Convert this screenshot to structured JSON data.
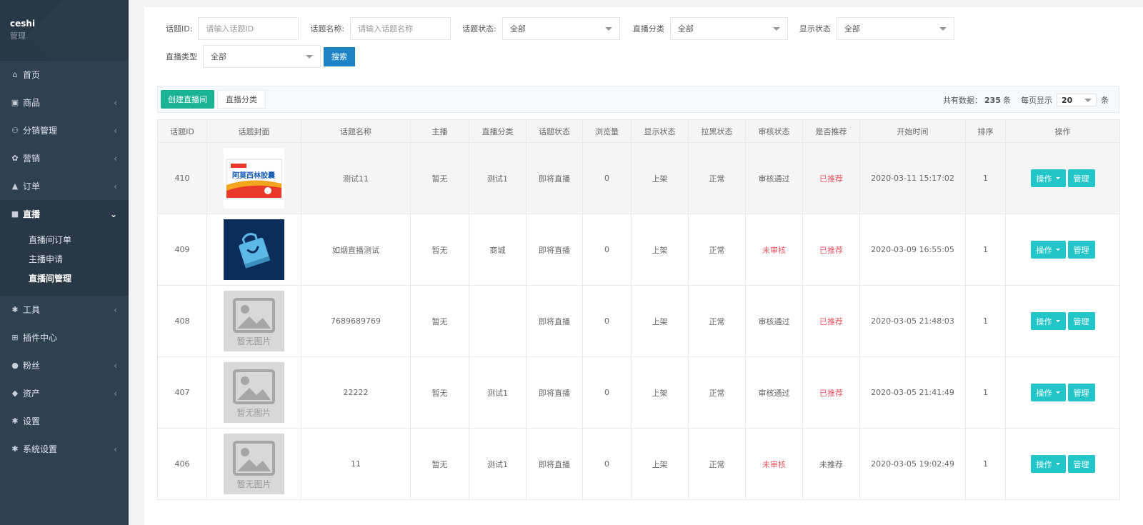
{
  "brand": {
    "name": "ceshi",
    "sub": "管理"
  },
  "menu": [
    {
      "label": "首页",
      "icon": "home-icon",
      "glyph": "⌂",
      "arrow": ""
    },
    {
      "label": "商品",
      "icon": "book-icon",
      "glyph": "▣",
      "arrow": "‹"
    },
    {
      "label": "分销管理",
      "icon": "users-icon",
      "glyph": "⚇",
      "arrow": "‹"
    },
    {
      "label": "营销",
      "icon": "gift-icon",
      "glyph": "✿",
      "arrow": "‹"
    },
    {
      "label": "订单",
      "icon": "bag-icon",
      "glyph": "▲",
      "arrow": "‹"
    },
    {
      "label": "直播",
      "icon": "video-icon",
      "glyph": "■",
      "arrow": "⌄"
    },
    {
      "label": "工具",
      "icon": "cog-icon",
      "glyph": "✱",
      "arrow": "‹"
    },
    {
      "label": "插件中心",
      "icon": "sitemap-icon",
      "glyph": "⊞",
      "arrow": ""
    },
    {
      "label": "粉丝",
      "icon": "user-icon",
      "glyph": "●",
      "arrow": "‹"
    },
    {
      "label": "资产",
      "icon": "diamond-icon",
      "glyph": "◆",
      "arrow": "‹"
    },
    {
      "label": "设置",
      "icon": "gear-icon",
      "glyph": "✱",
      "arrow": ""
    },
    {
      "label": "系统设置",
      "icon": "gear-icon",
      "glyph": "✱",
      "arrow": "‹"
    }
  ],
  "submenu": [
    "直播间订单",
    "主播申请",
    "直播间管理"
  ],
  "filters": {
    "topic_id_label": "话题ID:",
    "topic_id_placeholder": "请输入话题ID",
    "topic_name_label": "话题名称:",
    "topic_name_placeholder": "请输入话题名称",
    "topic_status_label": "话题状态:",
    "topic_status_value": "全部",
    "live_category_label": "直播分类",
    "live_category_value": "全部",
    "display_status_label": "显示状态",
    "display_status_value": "全部",
    "live_type_label": "直播类型",
    "live_type_value": "全部",
    "search_label": "搜索"
  },
  "toolbar": {
    "create_label": "创建直播间",
    "category_label": "直播分类",
    "total_prefix": "共有数据：",
    "total_count": "235",
    "total_unit": "条",
    "per_page_label": "每页显示",
    "per_page_value": "20",
    "per_page_unit": "条"
  },
  "table": {
    "headers": [
      "话题ID",
      "话题封面",
      "话题名称",
      "主播",
      "直播分类",
      "话题状态",
      "浏览量",
      "显示状态",
      "拉黑状态",
      "审核状态",
      "是否推荐",
      "开始时间",
      "排序",
      "操作"
    ],
    "rows": [
      {
        "id": "410",
        "cover": "medicine",
        "name": "测试11",
        "anchor": "暂无",
        "category": "测试1",
        "status": "即将直播",
        "views": "0",
        "display": "上架",
        "blacklist": "正常",
        "review": "审核通过",
        "review_red": false,
        "recommend": "已推荐",
        "recommend_red": true,
        "start": "2020-03-11 15:17:02",
        "sort": "1"
      },
      {
        "id": "409",
        "cover": "bag",
        "name": "如烟直播测试",
        "anchor": "暂无",
        "category": "商城",
        "status": "即将直播",
        "views": "0",
        "display": "上架",
        "blacklist": "正常",
        "review": "未审核",
        "review_red": true,
        "recommend": "已推荐",
        "recommend_red": true,
        "start": "2020-03-09 16:55:05",
        "sort": "1"
      },
      {
        "id": "408",
        "cover": "none",
        "name": "7689689769",
        "anchor": "暂无",
        "category": "",
        "status": "即将直播",
        "views": "0",
        "display": "上架",
        "blacklist": "正常",
        "review": "审核通过",
        "review_red": false,
        "recommend": "已推荐",
        "recommend_red": true,
        "start": "2020-03-05 21:48:03",
        "sort": "1"
      },
      {
        "id": "407",
        "cover": "none",
        "name": "22222",
        "anchor": "暂无",
        "category": "测试1",
        "status": "即将直播",
        "views": "0",
        "display": "上架",
        "blacklist": "正常",
        "review": "审核通过",
        "review_red": false,
        "recommend": "已推荐",
        "recommend_red": true,
        "start": "2020-03-05 21:41:49",
        "sort": "1"
      },
      {
        "id": "406",
        "cover": "none",
        "name": "11",
        "anchor": "暂无",
        "category": "测试1",
        "status": "即将直播",
        "views": "0",
        "display": "上架",
        "blacklist": "正常",
        "review": "未审核",
        "review_red": true,
        "recommend": "未推荐",
        "recommend_red": false,
        "start": "2020-03-05 19:02:49",
        "sort": "1"
      }
    ],
    "op_label": "操作",
    "manage_label": "管理",
    "no_image_text": "暂无图片",
    "medicine_brand": "阿莫西林胶囊",
    "medicine_top": "药材坊"
  }
}
